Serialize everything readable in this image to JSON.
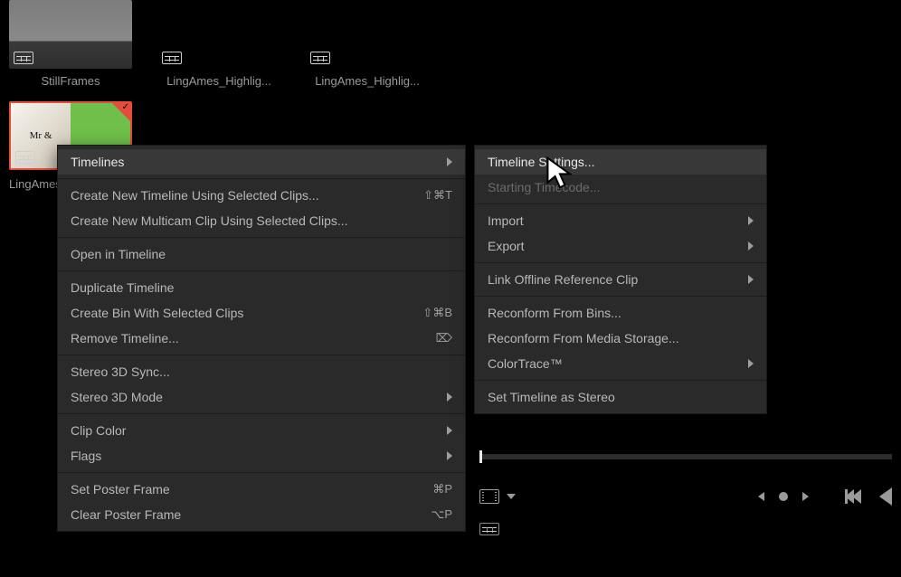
{
  "media_pool": {
    "items": [
      {
        "label": "StillFrames"
      },
      {
        "label": "LingAmes_Highlig..."
      },
      {
        "label": "LingAmes_Highlig..."
      }
    ],
    "selected": {
      "label": "LingAmes...",
      "logo_text": "Mr &"
    }
  },
  "context_menu": {
    "items": [
      {
        "label": "Timelines",
        "submenu": true,
        "highlight": true
      },
      {
        "sep": true
      },
      {
        "label": "Create New Timeline Using Selected Clips...",
        "shortcut": "⇧⌘T"
      },
      {
        "label": "Create New Multicam Clip Using Selected Clips..."
      },
      {
        "sep": true
      },
      {
        "label": "Open in Timeline"
      },
      {
        "sep": true
      },
      {
        "label": "Duplicate Timeline"
      },
      {
        "label": "Create Bin With Selected Clips",
        "shortcut": "⇧⌘B"
      },
      {
        "label": "Remove Timeline...",
        "shortcut": "⌦"
      },
      {
        "sep": true
      },
      {
        "label": "Stereo 3D Sync..."
      },
      {
        "label": "Stereo 3D Mode",
        "submenu": true
      },
      {
        "sep": true
      },
      {
        "label": "Clip Color",
        "submenu": true
      },
      {
        "label": "Flags",
        "submenu": true
      },
      {
        "sep": true
      },
      {
        "label": "Set Poster Frame",
        "shortcut": "⌘P"
      },
      {
        "label": "Clear Poster Frame",
        "shortcut": "⌥P"
      }
    ]
  },
  "submenu": {
    "items": [
      {
        "label": "Timeline Settings...",
        "highlight": true
      },
      {
        "label": "Starting Timecode...",
        "disabled": true
      },
      {
        "sep": true
      },
      {
        "label": "Import",
        "submenu": true
      },
      {
        "label": "Export",
        "submenu": true
      },
      {
        "sep": true
      },
      {
        "label": "Link Offline Reference Clip",
        "submenu": true
      },
      {
        "sep": true
      },
      {
        "label": "Reconform From Bins..."
      },
      {
        "label": "Reconform From Media Storage..."
      },
      {
        "label": "ColorTrace™",
        "submenu": true
      },
      {
        "sep": true
      },
      {
        "label": "Set Timeline as Stereo"
      }
    ]
  }
}
